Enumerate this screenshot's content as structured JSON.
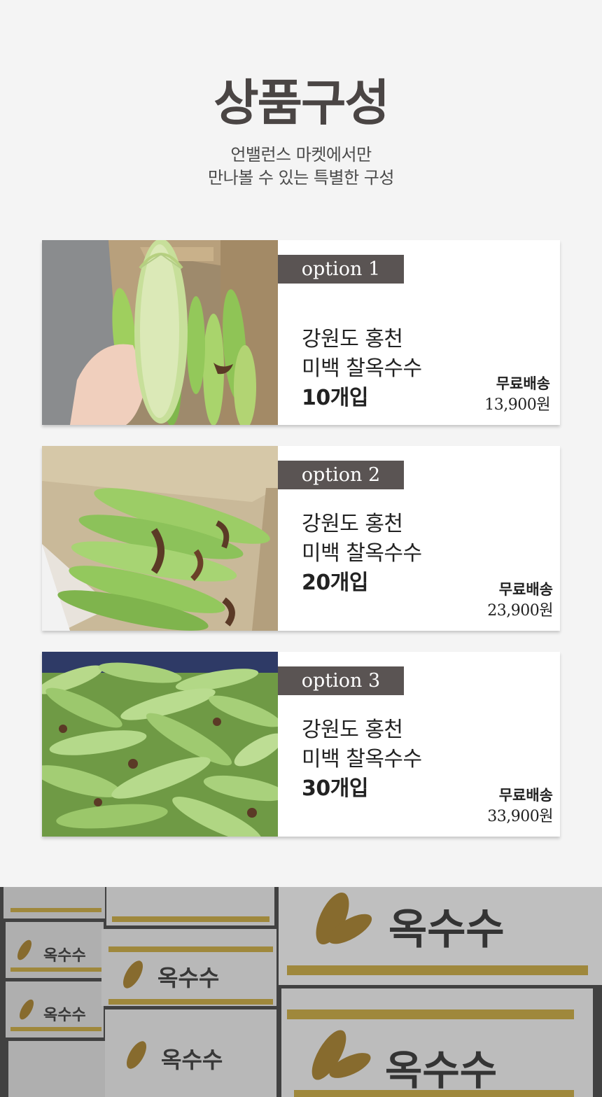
{
  "hero": {
    "title": "상품구성",
    "subtitle_line1": "언밸런스 마켓에서만",
    "subtitle_line2": "만나볼 수 있는 특별한 구성"
  },
  "options": [
    {
      "badge": "option 1",
      "line1": "강원도 홍천",
      "line2": "미백 찰옥수수",
      "quantity": "10개입",
      "shipping": "무료배송",
      "price": "13,900원"
    },
    {
      "badge": "option 2",
      "line1": "강원도 홍천",
      "line2": "미백 찰옥수수",
      "quantity": "20개입",
      "shipping": "무료배송",
      "price": "23,900원"
    },
    {
      "badge": "option 3",
      "line1": "강원도 홍천",
      "line2": "미백 찰옥수수",
      "quantity": "30개입",
      "shipping": "무료배송",
      "price": "33,900원"
    }
  ],
  "box_label": "옥수수",
  "colors": {
    "background": "#f4f4f4",
    "title": "#4a4544",
    "badge": "#5a5453",
    "card": "#ffffff",
    "corn_green": "#9cc46a",
    "box_stripe": "#e0b640"
  }
}
